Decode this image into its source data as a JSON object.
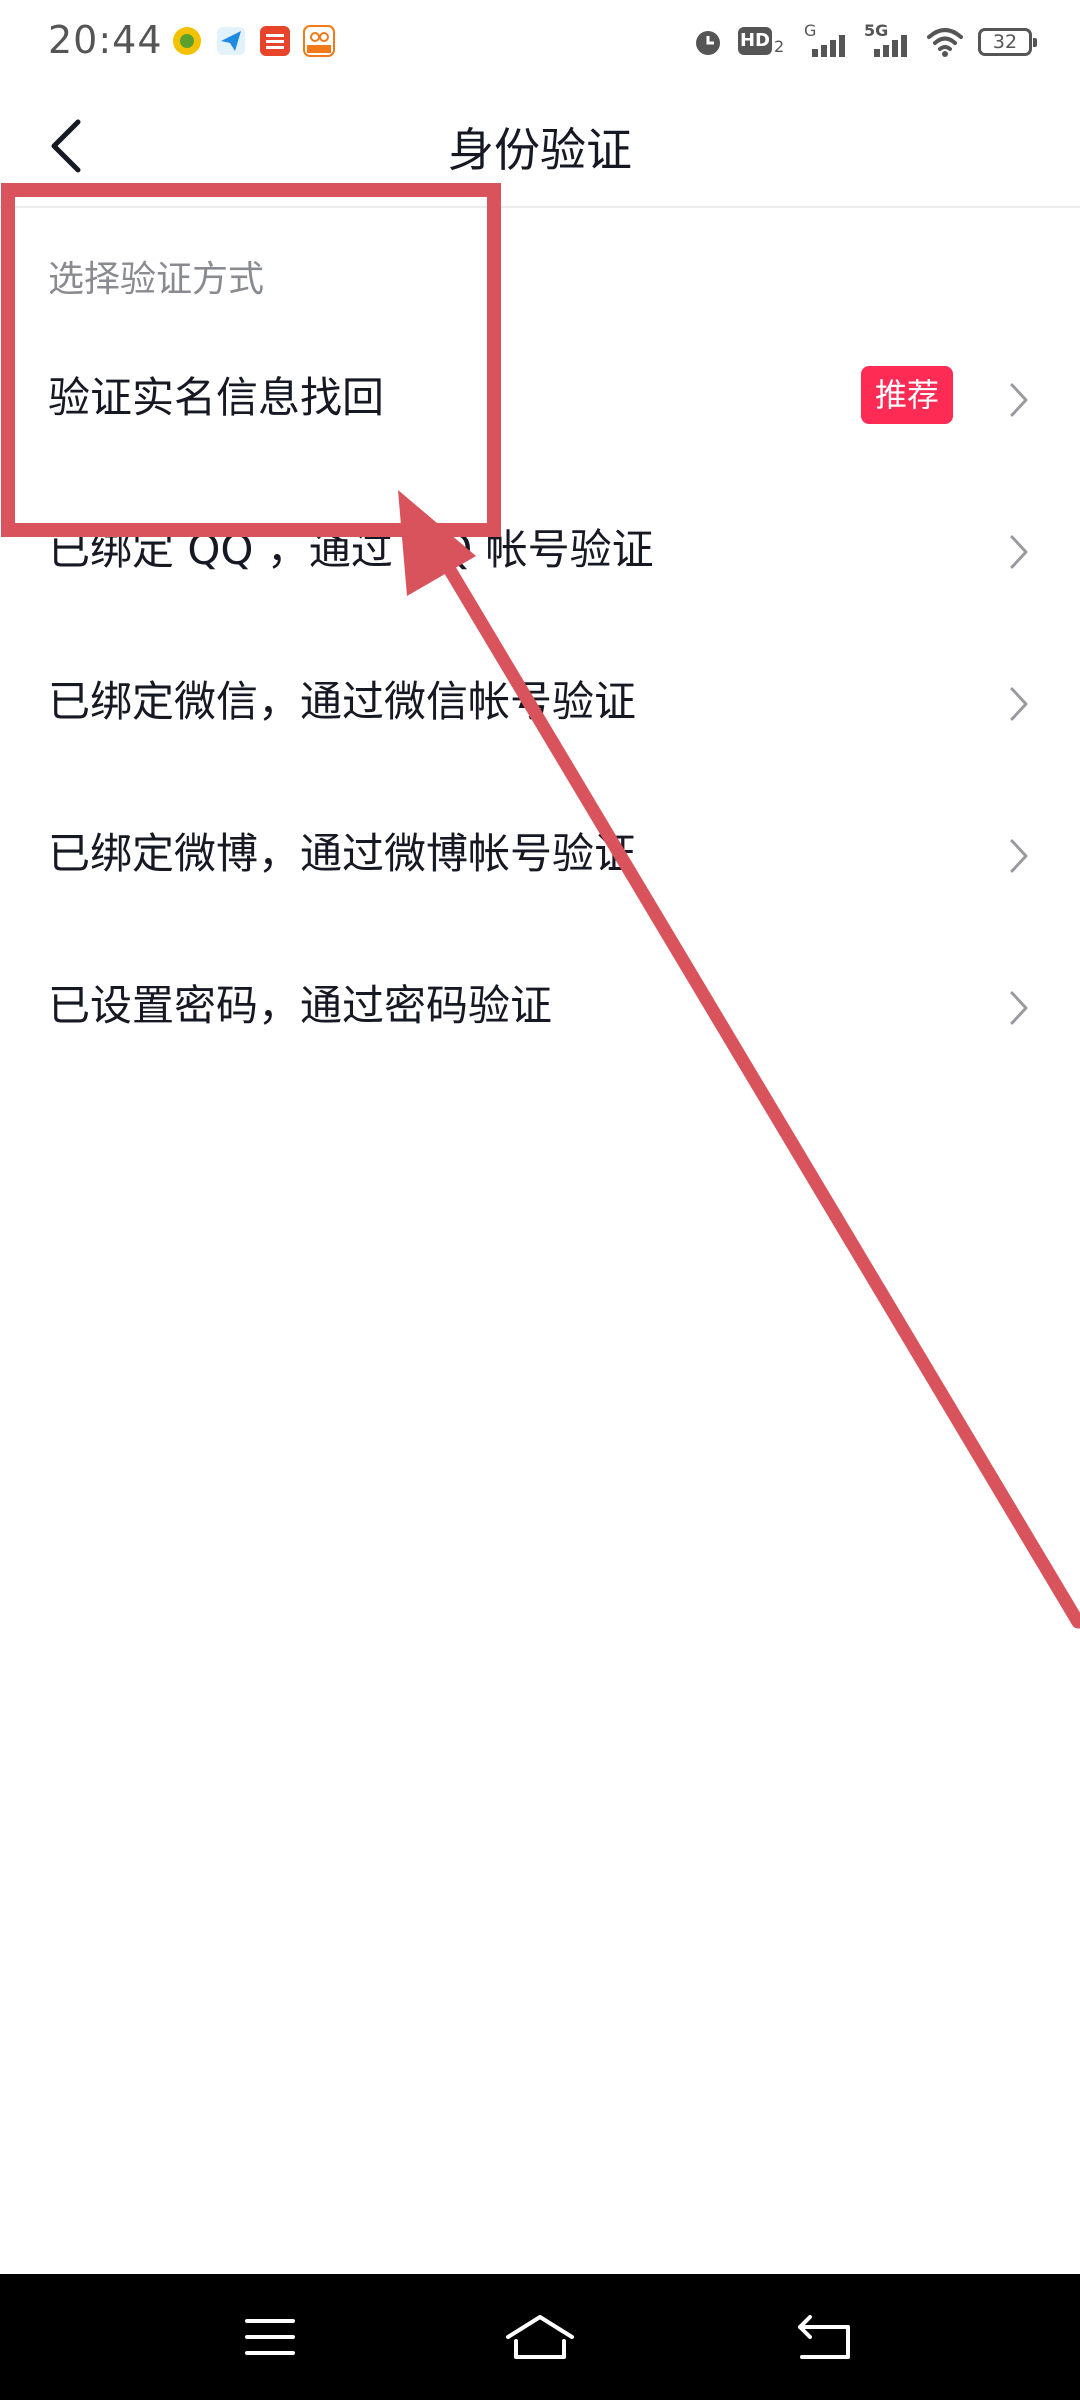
{
  "status_bar": {
    "time": "20:44",
    "battery": "32",
    "network_labels": [
      "HD",
      "2",
      "G",
      "5G"
    ],
    "icon_names": [
      "app-notification-icon-1",
      "app-notification-icon-2",
      "bank-app-icon",
      "58-app-icon",
      "alarm-icon",
      "hd-icon",
      "signal-icon",
      "signal-5g-icon",
      "wifi-icon",
      "battery-icon"
    ]
  },
  "nav": {
    "title": "身份验证",
    "back_icon": "chevron-left-icon"
  },
  "section": {
    "title": "选择验证方式"
  },
  "options": [
    {
      "label": "验证实名信息找回",
      "badge": "推荐"
    },
    {
      "label": "已绑定 QQ ，通过 QQ 帐号验证"
    },
    {
      "label": "已绑定微信，通过微信帐号验证"
    },
    {
      "label": "已绑定微博，通过微博帐号验证"
    },
    {
      "label": "已设置密码，通过密码验证"
    }
  ],
  "colors": {
    "badge": "#fe2c55",
    "annotation": "#d9535d",
    "text_primary": "#161823",
    "text_secondary": "#8a8b91"
  },
  "system_nav": {
    "icons": [
      "menu-icon",
      "home-icon",
      "back-icon"
    ]
  }
}
